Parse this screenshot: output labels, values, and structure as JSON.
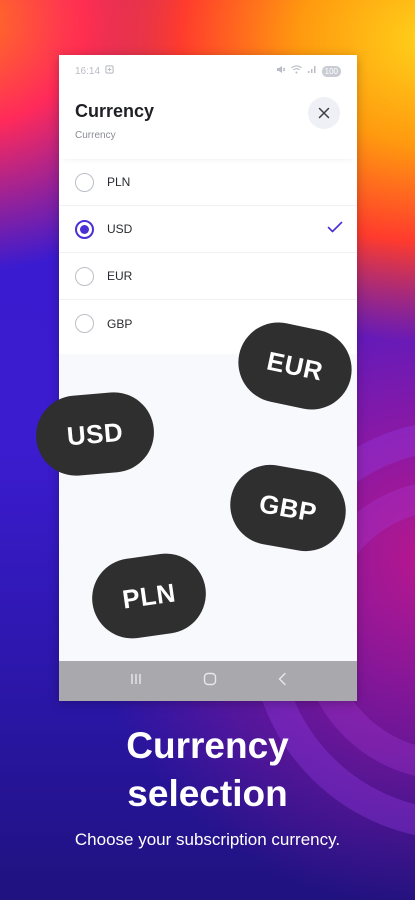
{
  "status_bar": {
    "time": "16:14",
    "battery": "100"
  },
  "header": {
    "title": "Currency",
    "subtitle": "Currency"
  },
  "options": [
    {
      "label": "PLN",
      "selected": false
    },
    {
      "label": "USD",
      "selected": true
    },
    {
      "label": "EUR",
      "selected": false
    },
    {
      "label": "GBP",
      "selected": false
    }
  ],
  "pills": {
    "eur": "EUR",
    "usd": "USD",
    "gbp": "GBP",
    "pln": "PLN"
  },
  "promo": {
    "headline_line1": "Currency",
    "headline_line2": "selection",
    "tagline": "Choose your subscription currency."
  },
  "colors": {
    "accent": "#4a2fd6",
    "pill": "#2f2f30"
  }
}
